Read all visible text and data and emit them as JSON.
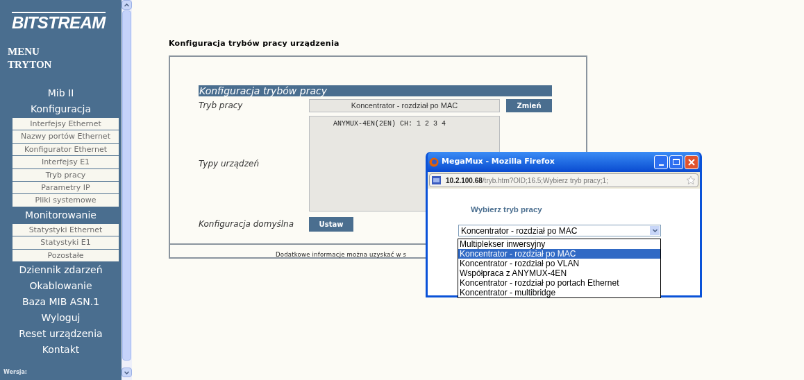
{
  "sidebar": {
    "logo": "BITSTREAM",
    "menu_title": [
      "MENU",
      "TRYTON"
    ],
    "items": [
      {
        "label": "Mib II",
        "kind": "header"
      },
      {
        "label": "Konfiguracja",
        "kind": "header"
      },
      {
        "label": "Interfejsy Ethernet",
        "kind": "subitem"
      },
      {
        "label": "Nazwy portów Ethernet",
        "kind": "subitem"
      },
      {
        "label": "Konfigurator Ethernet",
        "kind": "subitem"
      },
      {
        "label": "Interfejsy E1",
        "kind": "subitem"
      },
      {
        "label": "Tryb pracy",
        "kind": "subitem"
      },
      {
        "label": "Parametry IP",
        "kind": "subitem"
      },
      {
        "label": "Pliki systemowe",
        "kind": "subitem"
      },
      {
        "label": "Monitorowanie",
        "kind": "header"
      },
      {
        "label": "Statystyki Ethernet",
        "kind": "subitem"
      },
      {
        "label": "Statystyki E1",
        "kind": "subitem"
      },
      {
        "label": "Pozostałe",
        "kind": "subitem"
      },
      {
        "label": "Dziennik zdarzeń",
        "kind": "header"
      },
      {
        "label": "Okablowanie",
        "kind": "header"
      },
      {
        "label": "Baza MIB ASN.1",
        "kind": "header"
      },
      {
        "label": "Wyloguj",
        "kind": "header"
      },
      {
        "label": "Reset urządzenia",
        "kind": "header"
      },
      {
        "label": "Kontakt",
        "kind": "header"
      }
    ],
    "version_label": "Wersja:"
  },
  "page": {
    "heading": "Konfiguracja trybów pracy urządzenia",
    "panel": {
      "section_title": "Konfiguracja trybów pracy",
      "mode_label": "Tryb pracy",
      "mode_value": "Koncentrator - rozdział po MAC",
      "change_button": "Zmień",
      "types_label": "Typy urządzeń",
      "types_value": "ANYMUX-4EN(2EN) CH: 1 2 3 4",
      "default_label": "Konfiguracja domyślna",
      "set_button": "Ustaw"
    },
    "footer": "Dodatkowe informacje można uzyskać w s"
  },
  "popup": {
    "title": "MegaMux - Mozilla Firefox",
    "url_host": "10.2.100.68",
    "url_path": "/tryb.htm?OID;16.5;Wybierz tryb pracy;1;",
    "heading": "Wybierz tryb pracy",
    "select_value": "Koncentrator - rozdział po MAC",
    "options": [
      {
        "label": "Multiplekser inwersyjny",
        "selected": false
      },
      {
        "label": "Koncentrator - rozdział po MAC",
        "selected": true
      },
      {
        "label": "Koncentrator - rozdział po VLAN",
        "selected": false
      },
      {
        "label": "Współpraca z ANYMUX-4EN",
        "selected": false
      },
      {
        "label": "Koncentrator - rozdział po portach Ethernet",
        "selected": false
      },
      {
        "label": "Koncentrator - multibridge",
        "selected": false
      }
    ]
  }
}
